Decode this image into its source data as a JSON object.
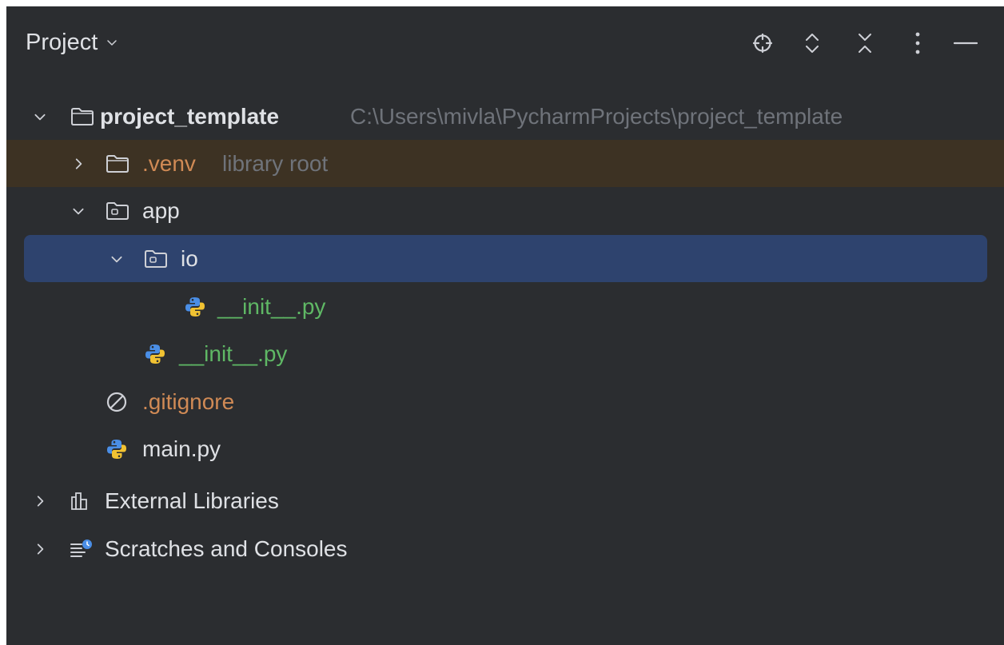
{
  "header": {
    "title": "Project",
    "icons": [
      "locate-icon",
      "expand-all-icon",
      "collapse-all-icon",
      "more-options-icon",
      "minimize-icon"
    ]
  },
  "tree": {
    "root": {
      "name": "project_template",
      "path": "C:\\Users\\mivla\\PycharmProjects\\project_template",
      "expanded": true
    },
    "venv": {
      "name": ".venv",
      "hint": "library root",
      "expanded": false
    },
    "app": {
      "name": "app",
      "expanded": true
    },
    "io": {
      "name": "io",
      "expanded": true,
      "selected": true
    },
    "io_init": {
      "name": "__init__.py"
    },
    "app_init": {
      "name": "__init__.py"
    },
    "gitignore": {
      "name": ".gitignore"
    },
    "main": {
      "name": "main.py"
    },
    "external": {
      "name": "External Libraries",
      "expanded": false
    },
    "scratches": {
      "name": "Scratches and Consoles",
      "expanded": false
    }
  },
  "colors": {
    "background": "#2b2d30",
    "selection": "#2e436e",
    "excluded_row": "#3d3223",
    "text": "#dfe1e5",
    "muted": "#6f737a",
    "python_file": "#5fb865",
    "ignored_file": "#d08a55"
  }
}
